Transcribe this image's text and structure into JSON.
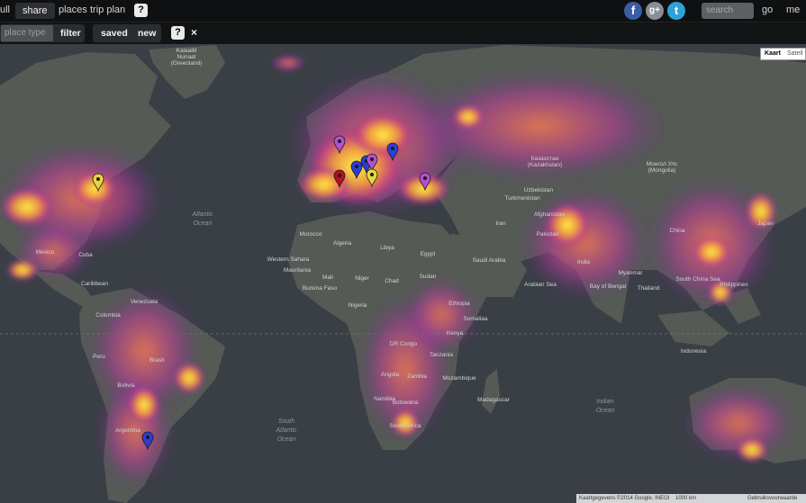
{
  "topbar": {
    "nav": [
      "ull",
      "share",
      "places",
      "trip plan"
    ],
    "help_label": "?",
    "search_placeholder": "search",
    "go_label": "go",
    "me_label": "me",
    "social": [
      "f",
      "g+",
      "t"
    ]
  },
  "toolbar": {
    "place_type_placeholder": "place type",
    "filter_label": "filter",
    "saved_label": "saved",
    "new_label": "new",
    "help_label": "?",
    "close_label": "×"
  },
  "map_toggle": {
    "map_label": "Kaart",
    "satellite_label": "Satell"
  },
  "footer": {
    "attribution": "Kaartgegevens ©2014 Google, INEGI",
    "scale": "1000 km",
    "terms": "Gebruiksvoorwaarde"
  },
  "map": {
    "oceans": [
      "Atlantic",
      "Ocean",
      "South",
      "Atlantic",
      "Ocean",
      "Indian",
      "Ocean"
    ],
    "labels": [
      "Kalaallit",
      "Nunaat",
      "(Greenland)",
      "Казахстан",
      "(Kazakhstan)",
      "Монгол Улс",
      "(Mongolia)",
      "Uzbekistan",
      "Turkmenistan",
      "Afghanistan",
      "Pakistan",
      "India",
      "China",
      "Iran",
      "Saudi Arabia",
      "Egypt",
      "Libya",
      "Algeria",
      "Mali",
      "Niger",
      "Chad",
      "Sudan",
      "Nigeria",
      "Ethiopia",
      "Somaliaa",
      "Kenya",
      "DR Congo",
      "Tanzania",
      "Angola",
      "Zambia",
      "Namibia",
      "Botswana",
      "South Africa",
      "Mozambique",
      "Madagascar",
      "Brasil",
      "Peru",
      "Bolivia",
      "Argentina",
      "Colombia",
      "Venezuela",
      "Mexico",
      "Cuba",
      "Caribbean",
      "Myanmar",
      "Thailand",
      "Indonesia",
      "Philippines",
      "Japan",
      "South China Sea",
      "Arabian Sea",
      "Bay of Bengal",
      "Burkina Faso",
      "Western Sahara",
      "Morocco",
      "Mauritania"
    ]
  },
  "markers": [
    {
      "id": "m1",
      "color": "#e6d73c",
      "type": "yellow"
    },
    {
      "id": "m2",
      "color": "#b34fd0",
      "type": "purple"
    },
    {
      "id": "m3",
      "color": "#b80f1f",
      "type": "red"
    },
    {
      "id": "m4",
      "color": "#2c3fd4",
      "type": "blue"
    },
    {
      "id": "m5",
      "color": "#2c3fd4",
      "type": "blue"
    },
    {
      "id": "m6",
      "color": "#b34fd0",
      "type": "purple"
    },
    {
      "id": "m7",
      "color": "#e6d73c",
      "type": "yellow"
    },
    {
      "id": "m8",
      "color": "#2c3fd4",
      "type": "blue"
    },
    {
      "id": "m9",
      "color": "#b34fd0",
      "type": "purple"
    },
    {
      "id": "m10",
      "color": "#2c3fd4",
      "type": "blue"
    }
  ],
  "colors": {
    "ocean": "#3a3f46",
    "land": "#565b55",
    "heat_low": "#7a2fa0",
    "heat_mid": "#e24d8c",
    "heat_high": "#ffe33b"
  }
}
